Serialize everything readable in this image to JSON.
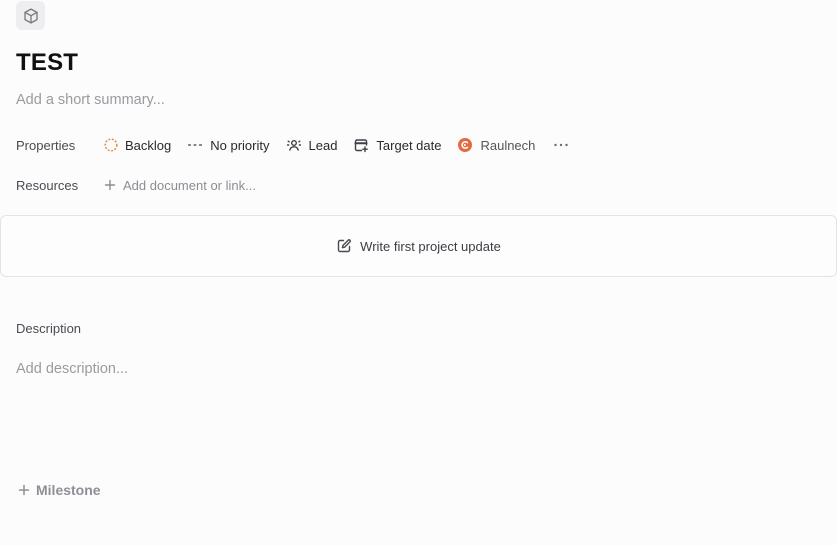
{
  "project": {
    "icon": "cube-icon",
    "title": "TEST",
    "summary_placeholder": "Add a short summary..."
  },
  "properties": {
    "label": "Properties",
    "status": {
      "label": "Backlog",
      "icon": "backlog-dashed-circle-icon",
      "color": "#e8893a"
    },
    "priority": {
      "label": "No priority",
      "icon": "no-priority-dashes-icon"
    },
    "lead": {
      "label": "Lead",
      "icon": "lead-person-icon"
    },
    "target_date": {
      "label": "Target date",
      "icon": "calendar-plus-icon"
    },
    "team": {
      "label": "Raulnech",
      "icon": "team-avatar-icon",
      "color": "#e36b3d"
    },
    "more_icon": "ellipsis-icon"
  },
  "resources": {
    "label": "Resources",
    "add_label": "Add document or link..."
  },
  "update": {
    "label": "Write first project update",
    "icon": "edit-square-icon"
  },
  "description": {
    "label": "Description",
    "placeholder": "Add description..."
  },
  "milestone": {
    "label": "Milestone"
  }
}
